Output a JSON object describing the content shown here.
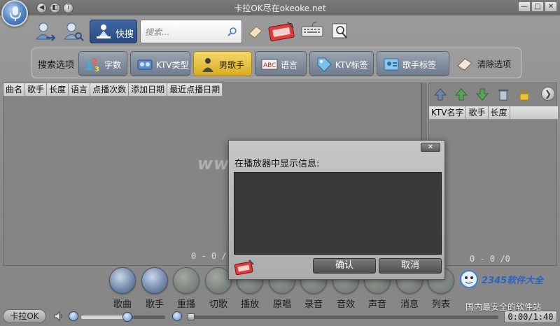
{
  "window": {
    "title": "卡拉OK尽在okeoke.net",
    "mini_buttons": [
      "◀",
      "◧",
      "i"
    ],
    "controls": {
      "minimize": "—",
      "maximize": "□",
      "close": "✕"
    }
  },
  "toolbar": {
    "quick_search_label": "快搜",
    "search_placeholder": "搜索..."
  },
  "options": {
    "label": "搜索选项",
    "buttons": [
      {
        "label": "字数",
        "icon": "digits-icon"
      },
      {
        "label": "KTV类型",
        "icon": "ktv-type-icon"
      },
      {
        "label": "男歌手",
        "icon": "male-singer-icon",
        "active": true
      },
      {
        "label": "语言",
        "icon": "language-icon"
      },
      {
        "label": "KTV标签",
        "icon": "ktv-tag-icon"
      },
      {
        "label": "歌手标签",
        "icon": "singer-tag-icon"
      }
    ],
    "clear_label": "清除选项"
  },
  "song_table": {
    "columns": [
      "曲名",
      "歌手",
      "长度",
      "语言",
      "点播次数",
      "添加日期",
      "最近点播日期"
    ],
    "pager": "0 - 0 /"
  },
  "playlist_table": {
    "columns": [
      "KTV名字",
      "歌手",
      "长度"
    ],
    "pager": "0 - 0 /0",
    "next_glyph": "❯"
  },
  "watermark": "www.duote.com",
  "bottom_buttons": [
    {
      "label": "歌曲",
      "dim": false
    },
    {
      "label": "歌手",
      "dim": false
    },
    {
      "label": "重播",
      "dim": true
    },
    {
      "label": "切歌",
      "dim": true
    },
    {
      "label": "播放",
      "dim": true
    },
    {
      "label": "原唱",
      "dim": true
    },
    {
      "label": "录音",
      "dim": true
    },
    {
      "label": "音效",
      "dim": true
    },
    {
      "label": "声音",
      "dim": true
    },
    {
      "label": "消息",
      "dim": true
    },
    {
      "label": "列表",
      "dim": true
    }
  ],
  "status": {
    "brand_button": "卡拉OK",
    "volume_level": 0.55,
    "time": "0:00/1:40"
  },
  "brand": {
    "logo_text": "2345软件大全",
    "tagline": "国内最安全的软件站"
  },
  "dialog": {
    "close_glyph": "✕",
    "title": "在播放器中显示信息:",
    "message_value": "",
    "confirm": "确认",
    "cancel": "取消"
  },
  "colors": {
    "accent_blue": "#2e5d98",
    "active_option": "#d8ac23",
    "panel": "#858585"
  }
}
